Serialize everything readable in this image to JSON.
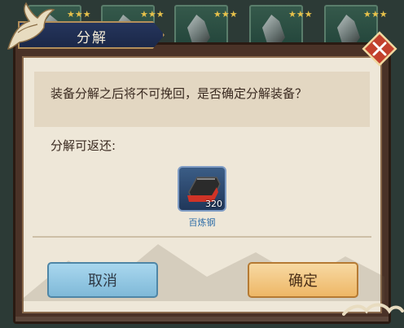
{
  "dialog": {
    "title": "分解",
    "message": "装备分解之后将不可挽回，是否确定分解装备？",
    "return_label": "分解可返还:"
  },
  "reward_item": {
    "name": "百炼钢",
    "count": "320"
  },
  "buttons": {
    "cancel": "取消",
    "confirm": "确定"
  },
  "slots": [
    {
      "stars": "★★★"
    },
    {
      "stars": "★★★"
    },
    {
      "stars": "★★★"
    },
    {
      "stars": "★★★"
    },
    {
      "stars": "★★★"
    }
  ],
  "colors": {
    "title_banner": "#1b2848",
    "cancel_button": "#7fb9d8",
    "confirm_button": "#eeb766",
    "item_name": "#2f6ea8"
  },
  "icons": [
    "crane-icon",
    "close-icon",
    "steel-ingot-icon",
    "blade-icon",
    "star-icon"
  ]
}
